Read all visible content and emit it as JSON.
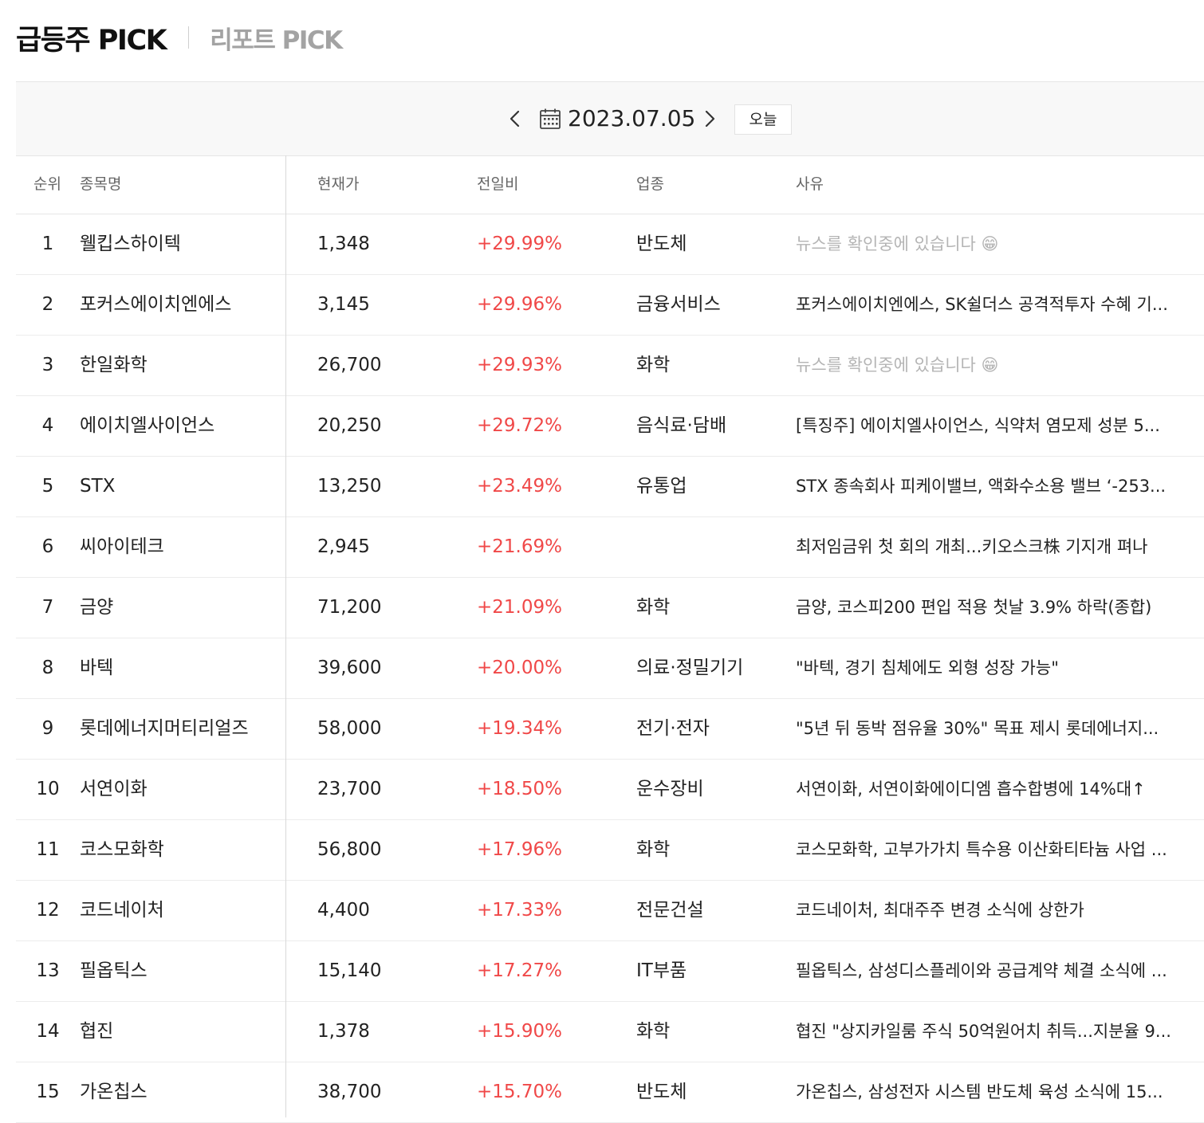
{
  "header": {
    "tab_active": "급등주 PICK",
    "tab_inactive": "리포트 PICK"
  },
  "date_bar": {
    "date": "2023.07.05",
    "today_label": "오늘",
    "prev_icon": "chevron-left-icon",
    "next_icon": "chevron-right-icon",
    "calendar_icon": "calendar-icon"
  },
  "table": {
    "columns": [
      "순위",
      "종목명",
      "현재가",
      "전일비",
      "업종",
      "사유"
    ],
    "rows": [
      {
        "rank": "1",
        "name": "웰킵스하이텍",
        "price": "1,348",
        "change": "+29.99%",
        "sector": "반도체",
        "reason": "뉴스를 확인중에 있습니다 😁",
        "reason_pending": true
      },
      {
        "rank": "2",
        "name": "포커스에이치엔에스",
        "price": "3,145",
        "change": "+29.96%",
        "sector": "금융서비스",
        "reason": "포커스에이치엔에스, SK쉴더스 공격적투자 수혜 기...",
        "reason_pending": false
      },
      {
        "rank": "3",
        "name": "한일화학",
        "price": "26,700",
        "change": "+29.93%",
        "sector": "화학",
        "reason": "뉴스를 확인중에 있습니다 😁",
        "reason_pending": true
      },
      {
        "rank": "4",
        "name": "에이치엘사이언스",
        "price": "20,250",
        "change": "+29.72%",
        "sector": "음식료·담배",
        "reason": "[특징주] 에이치엘사이언스, 식약처 염모제 성분 5...",
        "reason_pending": false
      },
      {
        "rank": "5",
        "name": "STX",
        "price": "13,250",
        "change": "+23.49%",
        "sector": "유통업",
        "reason": "STX 종속회사 피케이밸브, 액화수소용 밸브 ‘-253...",
        "reason_pending": false
      },
      {
        "rank": "6",
        "name": "씨아이테크",
        "price": "2,945",
        "change": "+21.69%",
        "sector": "",
        "reason": "최저임금위 첫 회의 개최...키오스크株 기지개 펴나",
        "reason_pending": false
      },
      {
        "rank": "7",
        "name": "금양",
        "price": "71,200",
        "change": "+21.09%",
        "sector": "화학",
        "reason": "금양, 코스피200 편입 적용 첫날 3.9% 하락(종합)",
        "reason_pending": false
      },
      {
        "rank": "8",
        "name": "바텍",
        "price": "39,600",
        "change": "+20.00%",
        "sector": "의료·정밀기기",
        "reason": "\"바텍, 경기 침체에도 외형 성장 가능\"",
        "reason_pending": false
      },
      {
        "rank": "9",
        "name": "롯데에너지머티리얼즈",
        "price": "58,000",
        "change": "+19.34%",
        "sector": "전기·전자",
        "reason": "\"5년 뒤 동박 점유율 30%\" 목표 제시 롯데에너지...",
        "reason_pending": false
      },
      {
        "rank": "10",
        "name": "서연이화",
        "price": "23,700",
        "change": "+18.50%",
        "sector": "운수장비",
        "reason": "서연이화, 서연이화에이디엠 흡수합병에 14%대↑",
        "reason_pending": false
      },
      {
        "rank": "11",
        "name": "코스모화학",
        "price": "56,800",
        "change": "+17.96%",
        "sector": "화학",
        "reason": "코스모화학, 고부가가치 특수용 이산화티타늄 사업 ...",
        "reason_pending": false
      },
      {
        "rank": "12",
        "name": "코드네이처",
        "price": "4,400",
        "change": "+17.33%",
        "sector": "전문건설",
        "reason": "코드네이처, 최대주주 변경 소식에 상한가",
        "reason_pending": false
      },
      {
        "rank": "13",
        "name": "필옵틱스",
        "price": "15,140",
        "change": "+17.27%",
        "sector": "IT부품",
        "reason": "필옵틱스, 삼성디스플레이와 공급계약 체결 소식에 ...",
        "reason_pending": false
      },
      {
        "rank": "14",
        "name": "협진",
        "price": "1,378",
        "change": "+15.90%",
        "sector": "화학",
        "reason": "협진 \"상지카일룸 주식 50억원어치 취득...지분율 9...",
        "reason_pending": false
      },
      {
        "rank": "15",
        "name": "가온칩스",
        "price": "38,700",
        "change": "+15.70%",
        "sector": "반도체",
        "reason": "가온칩스, 삼성전자 시스템 반도체 육성 소식에 15...",
        "reason_pending": false
      }
    ]
  },
  "colors": {
    "change_up": "#f04848",
    "pending_text": "#b4b4b4",
    "date_bar_bg": "#f8f8f8"
  }
}
